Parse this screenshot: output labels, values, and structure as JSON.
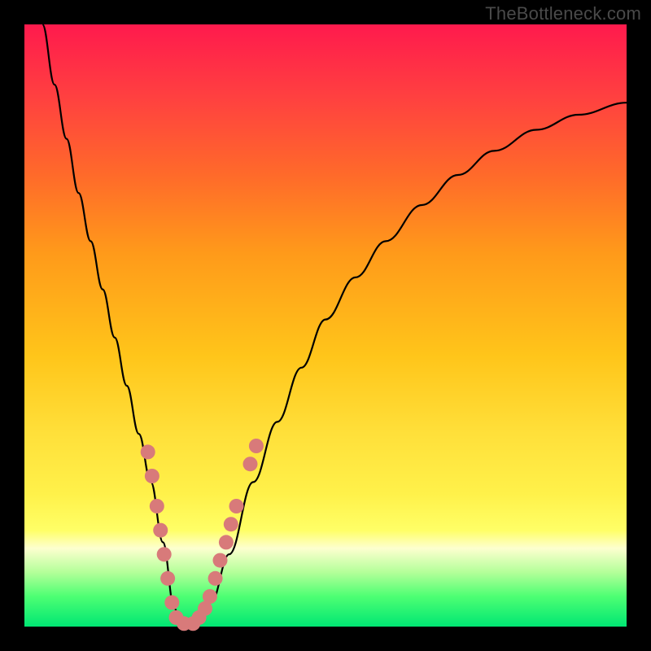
{
  "watermark": "TheBottleneck.com",
  "colors": {
    "curve": "#000000",
    "marker_fill": "#d87a7a",
    "marker_stroke": "#c96666"
  },
  "chart_data": {
    "type": "line",
    "title": "",
    "xlabel": "",
    "ylabel": "",
    "xlim": [
      0,
      100
    ],
    "ylim": [
      0,
      100
    ],
    "grid": false,
    "series": [
      {
        "name": "bottleneck-curve",
        "x": [
          3,
          5,
          7,
          9,
          11,
          13,
          15,
          17,
          19,
          21,
          23,
          24.9,
          26,
          28.5,
          31,
          34,
          38,
          42,
          46,
          50,
          55,
          60,
          66,
          72,
          78,
          85,
          92,
          100
        ],
        "y": [
          100,
          90,
          81,
          72,
          64,
          56,
          48,
          40,
          32,
          24,
          14,
          3,
          0.5,
          0.5,
          4,
          12,
          24,
          34,
          43,
          51,
          58,
          64,
          70,
          75,
          79,
          82.5,
          85,
          87
        ]
      }
    ],
    "markers": {
      "name": "highlighted-points",
      "points": [
        {
          "x": 20.5,
          "y": 29
        },
        {
          "x": 21.2,
          "y": 25
        },
        {
          "x": 22.0,
          "y": 20
        },
        {
          "x": 22.6,
          "y": 16
        },
        {
          "x": 23.2,
          "y": 12
        },
        {
          "x": 23.8,
          "y": 8
        },
        {
          "x": 24.5,
          "y": 4
        },
        {
          "x": 25.2,
          "y": 1.5
        },
        {
          "x": 26.5,
          "y": 0.5
        },
        {
          "x": 28.0,
          "y": 0.5
        },
        {
          "x": 29.0,
          "y": 1.5
        },
        {
          "x": 30.0,
          "y": 3
        },
        {
          "x": 30.8,
          "y": 5
        },
        {
          "x": 31.7,
          "y": 8
        },
        {
          "x": 32.5,
          "y": 11
        },
        {
          "x": 33.5,
          "y": 14
        },
        {
          "x": 34.3,
          "y": 17
        },
        {
          "x": 35.2,
          "y": 20
        },
        {
          "x": 37.5,
          "y": 27
        },
        {
          "x": 38.5,
          "y": 30
        }
      ]
    }
  }
}
